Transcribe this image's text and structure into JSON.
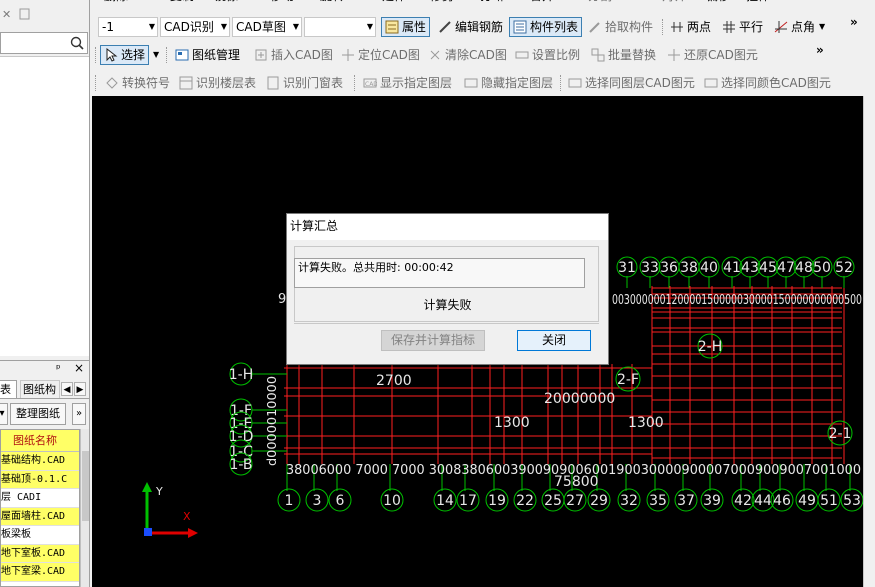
{
  "left_panel": {
    "pin_glyph": "ᵖ",
    "close_glyph": "×",
    "tabs": [
      "表",
      "图纸构"
    ],
    "organize_button": "整理图纸",
    "list_header": "图纸名称",
    "rows": [
      {
        "text": "基础结构.CAD",
        "yellow": true
      },
      {
        "text": "基础顶-0.1.C",
        "yellow": true
      },
      {
        "text": "层 CADI",
        "yellow": false
      },
      {
        "text": "屋面墙柱.CAD",
        "yellow": true
      },
      {
        "text": "板梁板",
        "yellow": false
      },
      {
        "text": "地下室板.CAD",
        "yellow": true
      },
      {
        "text": "地下室梁.CAD",
        "yellow": true
      }
    ]
  },
  "toolbar": {
    "row0": [
      "删除",
      "复制",
      "镜像",
      "移动",
      "旋转",
      "延伸",
      "修剪",
      "打断",
      "合并",
      "分割",
      "对齐",
      "偏移",
      "拉伸"
    ],
    "row1": {
      "combo_level": "-1",
      "combo_cad": "CAD识别",
      "combo_draft": "CAD草图",
      "combo_blank": "",
      "properties": "属性",
      "edit_rebar": "编辑钢筋",
      "component_list": "构件列表",
      "pick_component": "拾取构件",
      "two_points": "两点",
      "parallel": "平行",
      "point_angle": "点角"
    },
    "row2": {
      "select": "选择",
      "drawing_mgmt": "图纸管理",
      "insert_cad": "插入CAD图",
      "locate_cad": "定位CAD图",
      "clear_cad": "清除CAD图",
      "set_scale": "设置比例",
      "batch_replace": "批量替换",
      "restore_cad": "还原CAD图元"
    },
    "row3": {
      "convert_symbol": "转换符号",
      "identify_floor_table": "识别楼层表",
      "identify_door_window_table": "识别门窗表",
      "show_layer": "显示指定图层",
      "hide_layer": "隐藏指定图层",
      "select_same_layer": "选择同图层CAD图元",
      "select_same_color": "选择同颜色CAD图元"
    },
    "more": "»"
  },
  "canvas": {
    "top_axis": [
      "31",
      "33",
      "36",
      "38",
      "40",
      "41",
      "43",
      "45",
      "47",
      "48",
      "50",
      "52"
    ],
    "bottom_axis": [
      "1",
      "3",
      "6",
      "10",
      "14",
      "17",
      "19",
      "22",
      "25",
      "27",
      "29",
      "32",
      "35",
      "37",
      "39",
      "42",
      "44",
      "46",
      "49",
      "51",
      "53"
    ],
    "left_axis": [
      "1-H",
      "1-F",
      "1-E",
      "1-D",
      "1-C",
      "1-B"
    ],
    "right_labels": [
      "2-H",
      "2-F",
      "2-1"
    ],
    "dims": {
      "d2700": "2700",
      "d20000000": "20000000",
      "d1300a": "1300",
      "d1300b": "1300",
      "bottom_row": "38006000 7000   7000 30083806003900909006001900300009000070009009007001000",
      "total": "75800",
      "top_row": "003000000120000150000030000150000000000500",
      "left_vertical": "d0000010000",
      "top_left_9": "9"
    },
    "ucs": {
      "y_label": "Y",
      "x_label": "X"
    }
  },
  "dialog": {
    "title": "计算汇总",
    "message": "计算失败。总共用时: 00:00:42",
    "status": "计算失败",
    "save_button": "保存并计算指标",
    "close_button": "关闭"
  },
  "colors": {
    "canvas_bg": "#000000",
    "grid_red": "#ff2020",
    "axis_green": "#00c000",
    "dim_white": "#e8e8e8",
    "highlight_yellow": "#ffff66",
    "selected_blue": "#3c7fb1"
  }
}
